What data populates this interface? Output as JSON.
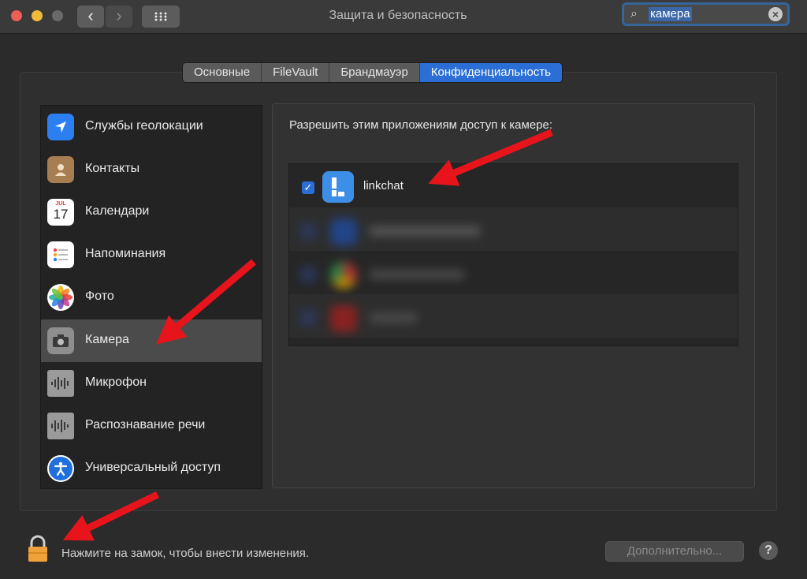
{
  "window": {
    "title": "Защита и безопасность",
    "back_glyph": "‹",
    "forward_glyph": "›"
  },
  "search": {
    "value": "камера",
    "icon": "search-icon",
    "clear_icon": "clear-icon"
  },
  "tabs": [
    {
      "label": "Основные"
    },
    {
      "label": "FileVault"
    },
    {
      "label": "Брандмауэр"
    },
    {
      "label": "Конфиденциальность"
    }
  ],
  "sidebar": {
    "items": [
      {
        "label": "Службы геолокации",
        "icon": "location-arrow-icon"
      },
      {
        "label": "Контакты",
        "icon": "contacts-book-icon"
      },
      {
        "label": "Календари",
        "icon": "calendar-icon",
        "calendar_month": "JUL",
        "calendar_day": "17"
      },
      {
        "label": "Напоминания",
        "icon": "reminders-icon"
      },
      {
        "label": "Фото",
        "icon": "photos-icon"
      },
      {
        "label": "Камера",
        "icon": "camera-icon"
      },
      {
        "label": "Микрофон",
        "icon": "microphone-waveform-icon"
      },
      {
        "label": "Распознавание речи",
        "icon": "speech-waveform-icon"
      },
      {
        "label": "Универсальный доступ",
        "icon": "accessibility-icon"
      }
    ]
  },
  "panel": {
    "heading": "Разрешить этим приложениям доступ к камере:",
    "apps": [
      {
        "name": "linkchat",
        "checked": true
      }
    ]
  },
  "footer": {
    "lock_text": "Нажмите на замок, чтобы внести изменения.",
    "advanced_label": "Дополнительно...",
    "help_label": "?"
  },
  "colors": {
    "accent": "#2b6fd6",
    "annotation_arrow": "#e8141c"
  }
}
